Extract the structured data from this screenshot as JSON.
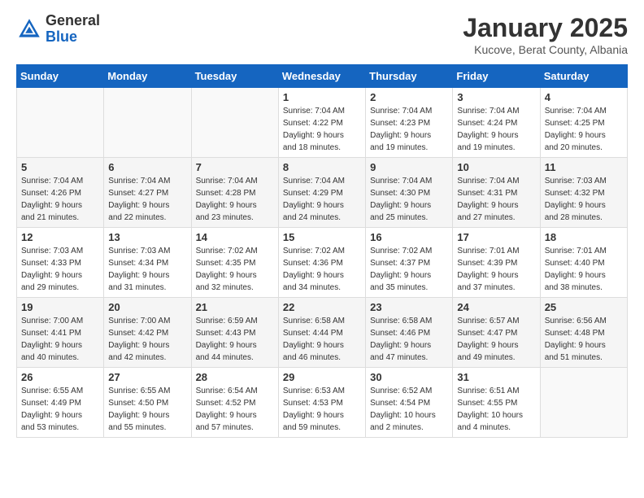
{
  "header": {
    "logo_general": "General",
    "logo_blue": "Blue",
    "title": "January 2025",
    "location": "Kucove, Berat County, Albania"
  },
  "days_of_week": [
    "Sunday",
    "Monday",
    "Tuesday",
    "Wednesday",
    "Thursday",
    "Friday",
    "Saturday"
  ],
  "weeks": [
    [
      {
        "day": "",
        "info": ""
      },
      {
        "day": "",
        "info": ""
      },
      {
        "day": "",
        "info": ""
      },
      {
        "day": "1",
        "info": "Sunrise: 7:04 AM\nSunset: 4:22 PM\nDaylight: 9 hours\nand 18 minutes."
      },
      {
        "day": "2",
        "info": "Sunrise: 7:04 AM\nSunset: 4:23 PM\nDaylight: 9 hours\nand 19 minutes."
      },
      {
        "day": "3",
        "info": "Sunrise: 7:04 AM\nSunset: 4:24 PM\nDaylight: 9 hours\nand 19 minutes."
      },
      {
        "day": "4",
        "info": "Sunrise: 7:04 AM\nSunset: 4:25 PM\nDaylight: 9 hours\nand 20 minutes."
      }
    ],
    [
      {
        "day": "5",
        "info": "Sunrise: 7:04 AM\nSunset: 4:26 PM\nDaylight: 9 hours\nand 21 minutes."
      },
      {
        "day": "6",
        "info": "Sunrise: 7:04 AM\nSunset: 4:27 PM\nDaylight: 9 hours\nand 22 minutes."
      },
      {
        "day": "7",
        "info": "Sunrise: 7:04 AM\nSunset: 4:28 PM\nDaylight: 9 hours\nand 23 minutes."
      },
      {
        "day": "8",
        "info": "Sunrise: 7:04 AM\nSunset: 4:29 PM\nDaylight: 9 hours\nand 24 minutes."
      },
      {
        "day": "9",
        "info": "Sunrise: 7:04 AM\nSunset: 4:30 PM\nDaylight: 9 hours\nand 25 minutes."
      },
      {
        "day": "10",
        "info": "Sunrise: 7:04 AM\nSunset: 4:31 PM\nDaylight: 9 hours\nand 27 minutes."
      },
      {
        "day": "11",
        "info": "Sunrise: 7:03 AM\nSunset: 4:32 PM\nDaylight: 9 hours\nand 28 minutes."
      }
    ],
    [
      {
        "day": "12",
        "info": "Sunrise: 7:03 AM\nSunset: 4:33 PM\nDaylight: 9 hours\nand 29 minutes."
      },
      {
        "day": "13",
        "info": "Sunrise: 7:03 AM\nSunset: 4:34 PM\nDaylight: 9 hours\nand 31 minutes."
      },
      {
        "day": "14",
        "info": "Sunrise: 7:02 AM\nSunset: 4:35 PM\nDaylight: 9 hours\nand 32 minutes."
      },
      {
        "day": "15",
        "info": "Sunrise: 7:02 AM\nSunset: 4:36 PM\nDaylight: 9 hours\nand 34 minutes."
      },
      {
        "day": "16",
        "info": "Sunrise: 7:02 AM\nSunset: 4:37 PM\nDaylight: 9 hours\nand 35 minutes."
      },
      {
        "day": "17",
        "info": "Sunrise: 7:01 AM\nSunset: 4:39 PM\nDaylight: 9 hours\nand 37 minutes."
      },
      {
        "day": "18",
        "info": "Sunrise: 7:01 AM\nSunset: 4:40 PM\nDaylight: 9 hours\nand 38 minutes."
      }
    ],
    [
      {
        "day": "19",
        "info": "Sunrise: 7:00 AM\nSunset: 4:41 PM\nDaylight: 9 hours\nand 40 minutes."
      },
      {
        "day": "20",
        "info": "Sunrise: 7:00 AM\nSunset: 4:42 PM\nDaylight: 9 hours\nand 42 minutes."
      },
      {
        "day": "21",
        "info": "Sunrise: 6:59 AM\nSunset: 4:43 PM\nDaylight: 9 hours\nand 44 minutes."
      },
      {
        "day": "22",
        "info": "Sunrise: 6:58 AM\nSunset: 4:44 PM\nDaylight: 9 hours\nand 46 minutes."
      },
      {
        "day": "23",
        "info": "Sunrise: 6:58 AM\nSunset: 4:46 PM\nDaylight: 9 hours\nand 47 minutes."
      },
      {
        "day": "24",
        "info": "Sunrise: 6:57 AM\nSunset: 4:47 PM\nDaylight: 9 hours\nand 49 minutes."
      },
      {
        "day": "25",
        "info": "Sunrise: 6:56 AM\nSunset: 4:48 PM\nDaylight: 9 hours\nand 51 minutes."
      }
    ],
    [
      {
        "day": "26",
        "info": "Sunrise: 6:55 AM\nSunset: 4:49 PM\nDaylight: 9 hours\nand 53 minutes."
      },
      {
        "day": "27",
        "info": "Sunrise: 6:55 AM\nSunset: 4:50 PM\nDaylight: 9 hours\nand 55 minutes."
      },
      {
        "day": "28",
        "info": "Sunrise: 6:54 AM\nSunset: 4:52 PM\nDaylight: 9 hours\nand 57 minutes."
      },
      {
        "day": "29",
        "info": "Sunrise: 6:53 AM\nSunset: 4:53 PM\nDaylight: 9 hours\nand 59 minutes."
      },
      {
        "day": "30",
        "info": "Sunrise: 6:52 AM\nSunset: 4:54 PM\nDaylight: 10 hours\nand 2 minutes."
      },
      {
        "day": "31",
        "info": "Sunrise: 6:51 AM\nSunset: 4:55 PM\nDaylight: 10 hours\nand 4 minutes."
      },
      {
        "day": "",
        "info": ""
      }
    ]
  ]
}
